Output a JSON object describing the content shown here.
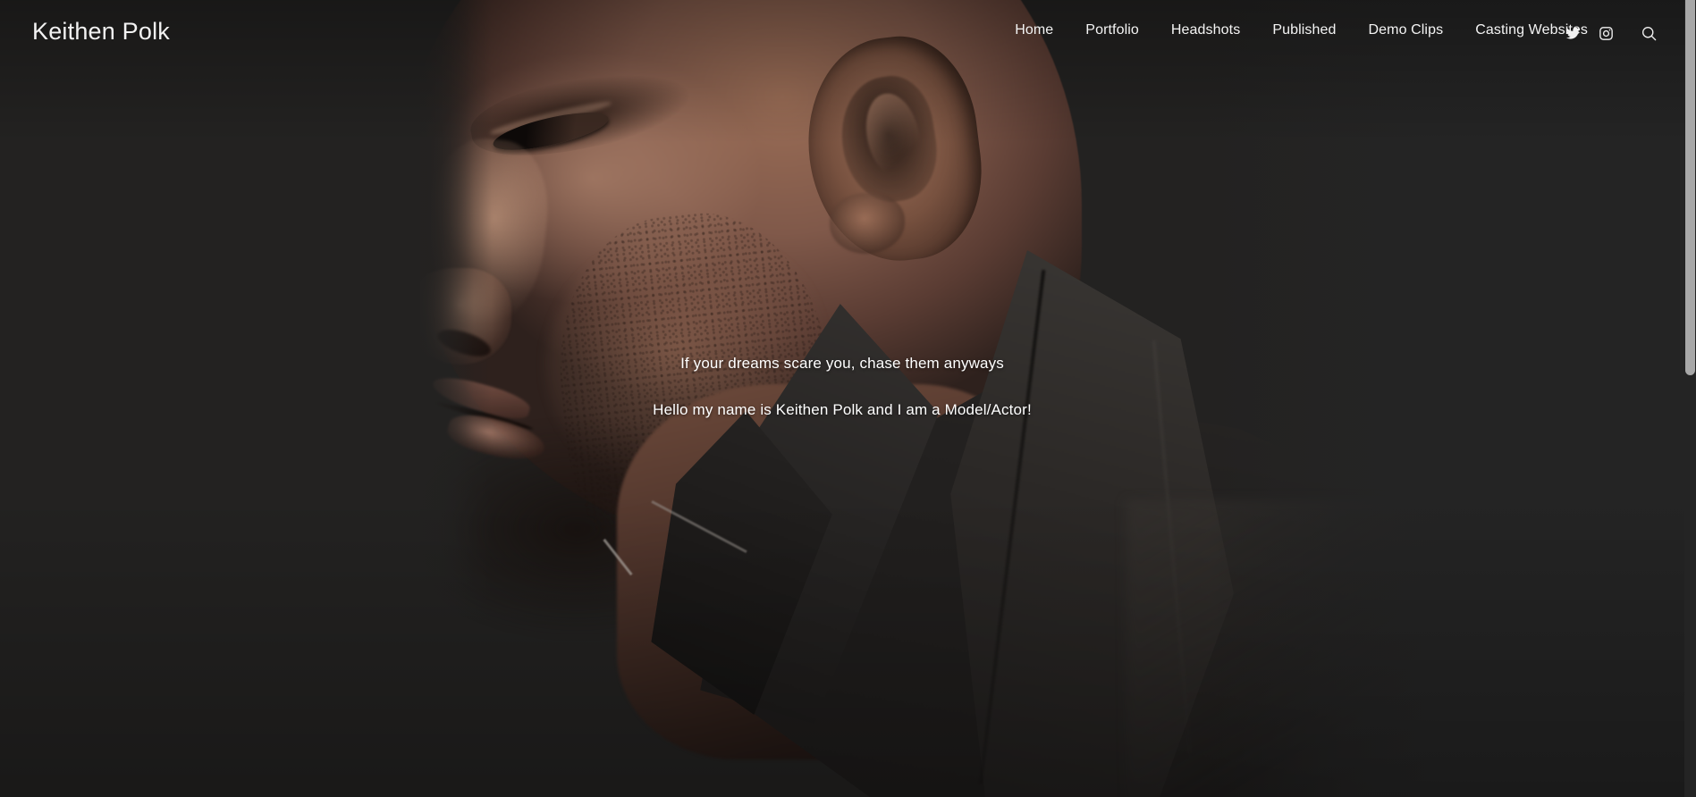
{
  "site": {
    "logo": "Keithen Polk"
  },
  "nav": {
    "items": [
      {
        "label": "Home"
      },
      {
        "label": "Portfolio"
      },
      {
        "label": "Headshots"
      },
      {
        "label": "Published"
      },
      {
        "label": "Demo Clips"
      },
      {
        "label": "Casting Websites"
      }
    ]
  },
  "header_icons": [
    {
      "name": "twitter-icon"
    },
    {
      "name": "instagram-icon"
    },
    {
      "name": "search-icon"
    }
  ],
  "hero": {
    "tagline": "If your dreams scare you, chase them anyways",
    "intro": "Hello my name is Keithen Polk and I am a Model/Actor!"
  },
  "colors": {
    "page_background": "#242424",
    "panel_background": "#232221",
    "text": "#ffffff",
    "logo_text": "#f2f2f2",
    "scrollbar_thumb": "#a8a8a8"
  }
}
